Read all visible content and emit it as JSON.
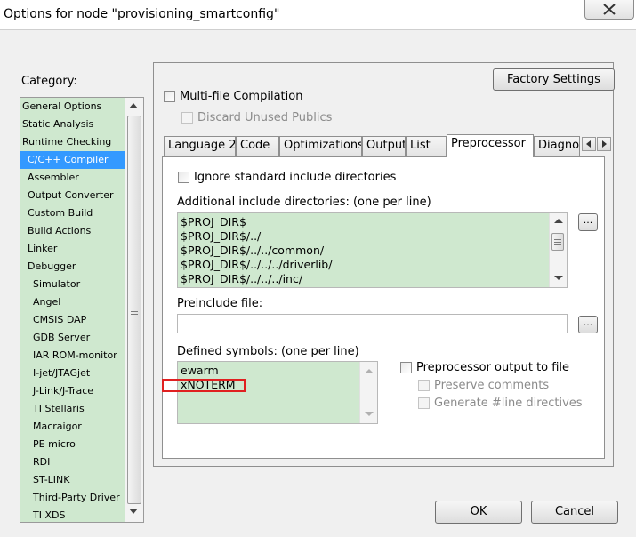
{
  "window": {
    "title": "Options for node \"provisioning_smartconfig\""
  },
  "category": {
    "label": "Category:",
    "items": [
      {
        "label": "General Options",
        "indent": 0
      },
      {
        "label": "Static Analysis",
        "indent": 0
      },
      {
        "label": "Runtime Checking",
        "indent": 0
      },
      {
        "label": "C/C++ Compiler",
        "indent": 1,
        "selected": true
      },
      {
        "label": "Assembler",
        "indent": 1
      },
      {
        "label": "Output Converter",
        "indent": 1
      },
      {
        "label": "Custom Build",
        "indent": 1
      },
      {
        "label": "Build Actions",
        "indent": 1
      },
      {
        "label": "Linker",
        "indent": 1
      },
      {
        "label": "Debugger",
        "indent": 1
      },
      {
        "label": "Simulator",
        "indent": 2
      },
      {
        "label": "Angel",
        "indent": 2
      },
      {
        "label": "CMSIS DAP",
        "indent": 2
      },
      {
        "label": "GDB Server",
        "indent": 2
      },
      {
        "label": "IAR ROM-monitor",
        "indent": 2
      },
      {
        "label": "I-jet/JTAGjet",
        "indent": 2
      },
      {
        "label": "J-Link/J-Trace",
        "indent": 2
      },
      {
        "label": "TI Stellaris",
        "indent": 2
      },
      {
        "label": "Macraigor",
        "indent": 2
      },
      {
        "label": "PE micro",
        "indent": 2
      },
      {
        "label": "RDI",
        "indent": 2
      },
      {
        "label": "ST-LINK",
        "indent": 2
      },
      {
        "label": "Third-Party Driver",
        "indent": 2
      },
      {
        "label": "TI XDS",
        "indent": 2
      }
    ]
  },
  "panel": {
    "factory_settings": "Factory Settings",
    "multi_file": {
      "label": "Multi-file Compilation",
      "checked": false
    },
    "discard_unused": {
      "label": "Discard Unused Publics",
      "checked": false,
      "disabled": true
    },
    "tabs": [
      "Language 2",
      "Code",
      "Optimizations",
      "Output",
      "List",
      "Preprocessor",
      "Diagnos"
    ],
    "active_tab": "Preprocessor"
  },
  "preprocessor": {
    "ignore_std": {
      "label": "Ignore standard include directories",
      "checked": false
    },
    "include_label": "Additional include directories: (one per line)",
    "include_dirs": [
      "$PROJ_DIR$",
      "$PROJ_DIR$/../",
      "$PROJ_DIR$/../../common/",
      "$PROJ_DIR$/../../../driverlib/",
      "$PROJ_DIR$/../../../inc/"
    ],
    "preinclude_label": "Preinclude file:",
    "preinclude_value": "",
    "browse_label": "...",
    "defined_label": "Defined symbols: (one per line)",
    "defined_symbols": [
      "ewarm",
      "xNOTERM"
    ],
    "output_to_file": {
      "label": "Preprocessor output to file",
      "checked": false
    },
    "preserve_comments": {
      "label": "Preserve comments",
      "checked": false,
      "disabled": true
    },
    "generate_line": {
      "label": "Generate #line directives",
      "checked": false,
      "disabled": true
    }
  },
  "buttons": {
    "ok": "OK",
    "cancel": "Cancel"
  },
  "colors": {
    "field_green": "#cfe8cf",
    "selection": "#3399ff",
    "highlight_box": "#e02020"
  }
}
